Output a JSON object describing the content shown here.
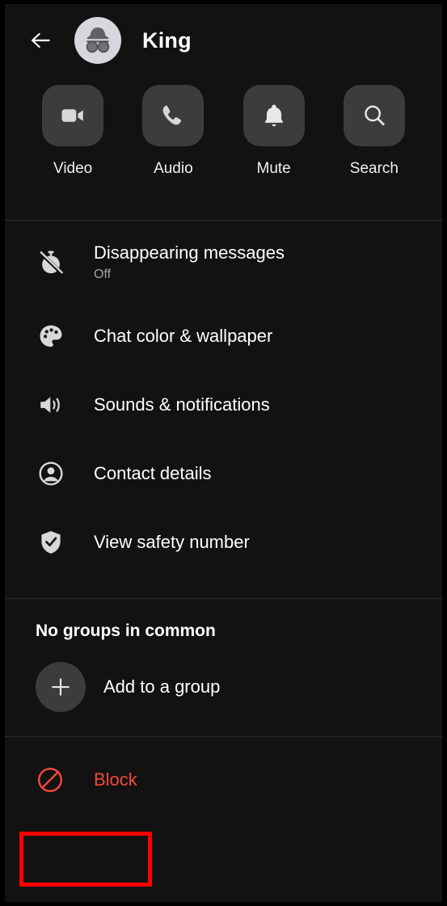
{
  "theme": {
    "background": "#121212",
    "tile": "#3c3c3c",
    "divider": "#2b2b2b",
    "text_primary": "#ffffff",
    "text_secondary": "#a4a4a4",
    "danger": "#f4483b",
    "highlight": "#ff0000",
    "avatar_background": "#d6d8dd"
  },
  "header": {
    "back_icon": "back-arrow-icon",
    "avatar_icon": "incognito-avatar-icon",
    "title": "King"
  },
  "quick_actions": [
    {
      "icon": "video-camera-icon",
      "label": "Video"
    },
    {
      "icon": "phone-icon",
      "label": "Audio"
    },
    {
      "icon": "bell-icon",
      "label": "Mute"
    },
    {
      "icon": "search-icon",
      "label": "Search"
    }
  ],
  "settings": [
    {
      "icon": "timer-off-icon",
      "title": "Disappearing messages",
      "subtitle": "Off"
    },
    {
      "icon": "palette-icon",
      "title": "Chat color & wallpaper",
      "subtitle": ""
    },
    {
      "icon": "speaker-icon",
      "title": "Sounds & notifications",
      "subtitle": ""
    },
    {
      "icon": "person-circle-icon",
      "title": "Contact details",
      "subtitle": ""
    },
    {
      "icon": "shield-check-icon",
      "title": "View safety number",
      "subtitle": ""
    }
  ],
  "groups": {
    "header": "No groups in common",
    "add_icon": "plus-icon",
    "add_label": "Add to a group"
  },
  "block": {
    "icon": "block-icon",
    "label": "Block"
  }
}
